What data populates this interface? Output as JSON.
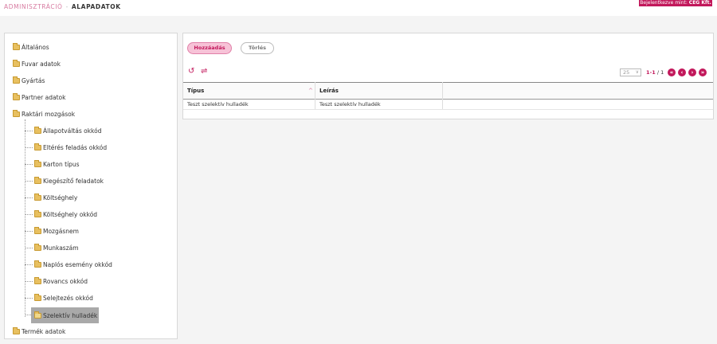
{
  "header": {
    "breadcrumb_root": "ADMINISZTRÁCIÓ",
    "breadcrumb_sep": "-",
    "breadcrumb_current": "ALAPADATOK",
    "login_prefix": "Bejelentkezve mint: ",
    "login_user": "CEG Kft."
  },
  "tree": {
    "items": [
      {
        "label": "Általános"
      },
      {
        "label": "Fuvar adatok"
      },
      {
        "label": "Gyártás"
      },
      {
        "label": "Partner adatok"
      },
      {
        "label": "Raktári mozgások"
      },
      {
        "label": "Termék adatok"
      }
    ],
    "children": [
      {
        "label": "Állapotváltás okkód"
      },
      {
        "label": "Eltérés feladás okkód"
      },
      {
        "label": "Karton típus"
      },
      {
        "label": "Kiegészítő feladatok"
      },
      {
        "label": "Költséghely"
      },
      {
        "label": "Költséghely okkód"
      },
      {
        "label": "Mozgásnem"
      },
      {
        "label": "Munkaszám"
      },
      {
        "label": "Naplós esemény okkód"
      },
      {
        "label": "Rovancs okkód"
      },
      {
        "label": "Selejtezés okkód"
      },
      {
        "label": "Szelektív hulladék"
      }
    ],
    "selected": "Szelektív hulladék"
  },
  "toolbar": {
    "add_label": "Hozzáadás",
    "delete_label": "Törlés"
  },
  "pager": {
    "page_size": "25",
    "range": "1-1",
    "total": " / 1"
  },
  "table": {
    "columns": [
      "Típus",
      "Leírás"
    ],
    "rows": [
      [
        "Teszt szelektív hulladék",
        "Teszt szelektív hulladék"
      ]
    ]
  },
  "colors": {
    "accent": "#c2185b",
    "accent_light": "#f7c2d7",
    "selected_bg": "#a9a9a9"
  }
}
